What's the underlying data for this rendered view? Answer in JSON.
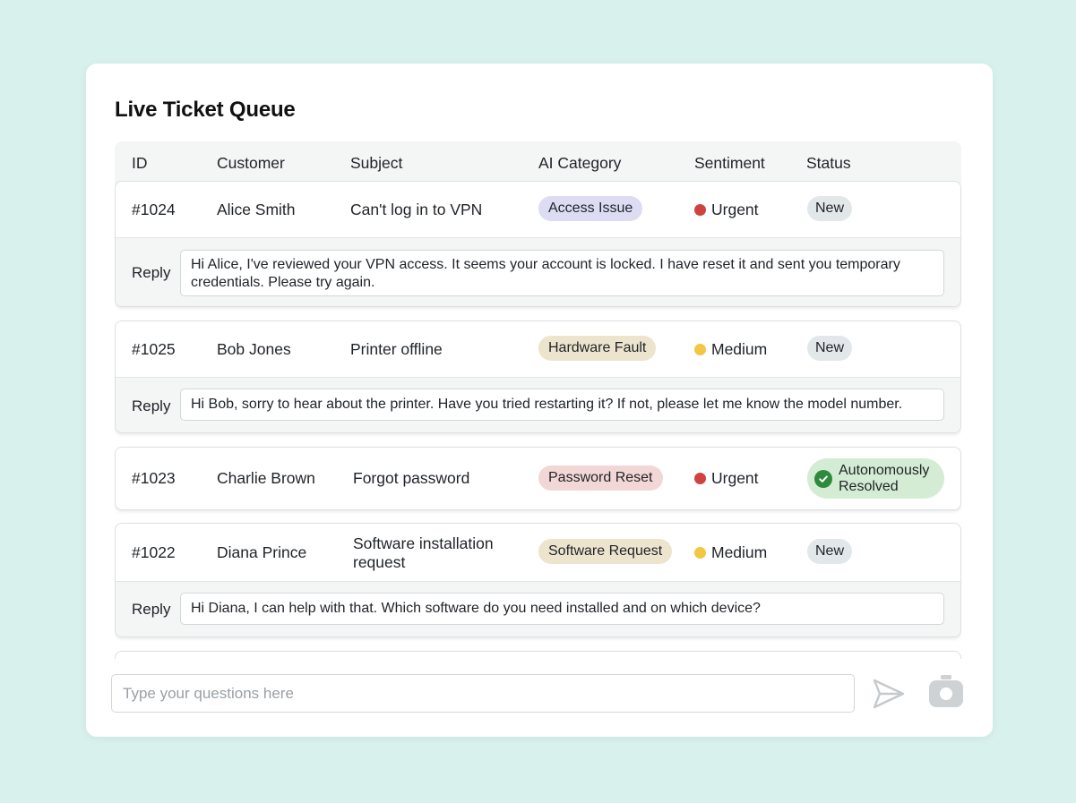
{
  "page": {
    "title": "Live Ticket Queue"
  },
  "table": {
    "headers": [
      "ID",
      "Customer",
      "Subject",
      "AI Category",
      "Sentiment",
      "Status"
    ],
    "reply_label": "Reply",
    "tickets": [
      {
        "id": "#1024",
        "customer": "Alice Smith",
        "subject": "Can't log in to VPN",
        "category": "Access Issue",
        "category_color": "#dcdcf3",
        "sentiment": "Urgent",
        "sentiment_color": "#d0423f",
        "status": "New",
        "reply": "Hi Alice, I've reviewed your VPN access. It seems your account is locked. I have reset it and sent you temporary credentials. Please try again."
      },
      {
        "id": "#1025",
        "customer": "Bob Jones",
        "subject": "Printer offline",
        "category": "Hardware Fault",
        "category_color": "#ede4cd",
        "sentiment": "Medium",
        "sentiment_color": "#f2c744",
        "status": "New",
        "reply": "Hi Bob, sorry to hear about the printer. Have you tried restarting it? If not, please let me know the model number."
      },
      {
        "id": "#1023",
        "customer": "Charlie Brown",
        "subject": "Forgot password",
        "category": "Password Reset",
        "category_color": "#f3d7d6",
        "sentiment": "Urgent",
        "sentiment_color": "#d0423f",
        "status": "Autonomously Resolved",
        "status_color": "#d5ecd4"
      },
      {
        "id": "#1022",
        "customer": "Diana Prince",
        "subject": "Software installation request",
        "category": "Software Request",
        "category_color": "#ede4cd",
        "sentiment": "Medium",
        "sentiment_color": "#f2c744",
        "status": "New",
        "reply": "Hi Diana, I can help with that. Which software do you need installed and on which device?"
      }
    ]
  },
  "composer": {
    "placeholder": "Type your questions here"
  },
  "icons": {
    "send": "send-icon",
    "camera": "camera-icon",
    "check": "check-circle-icon"
  }
}
